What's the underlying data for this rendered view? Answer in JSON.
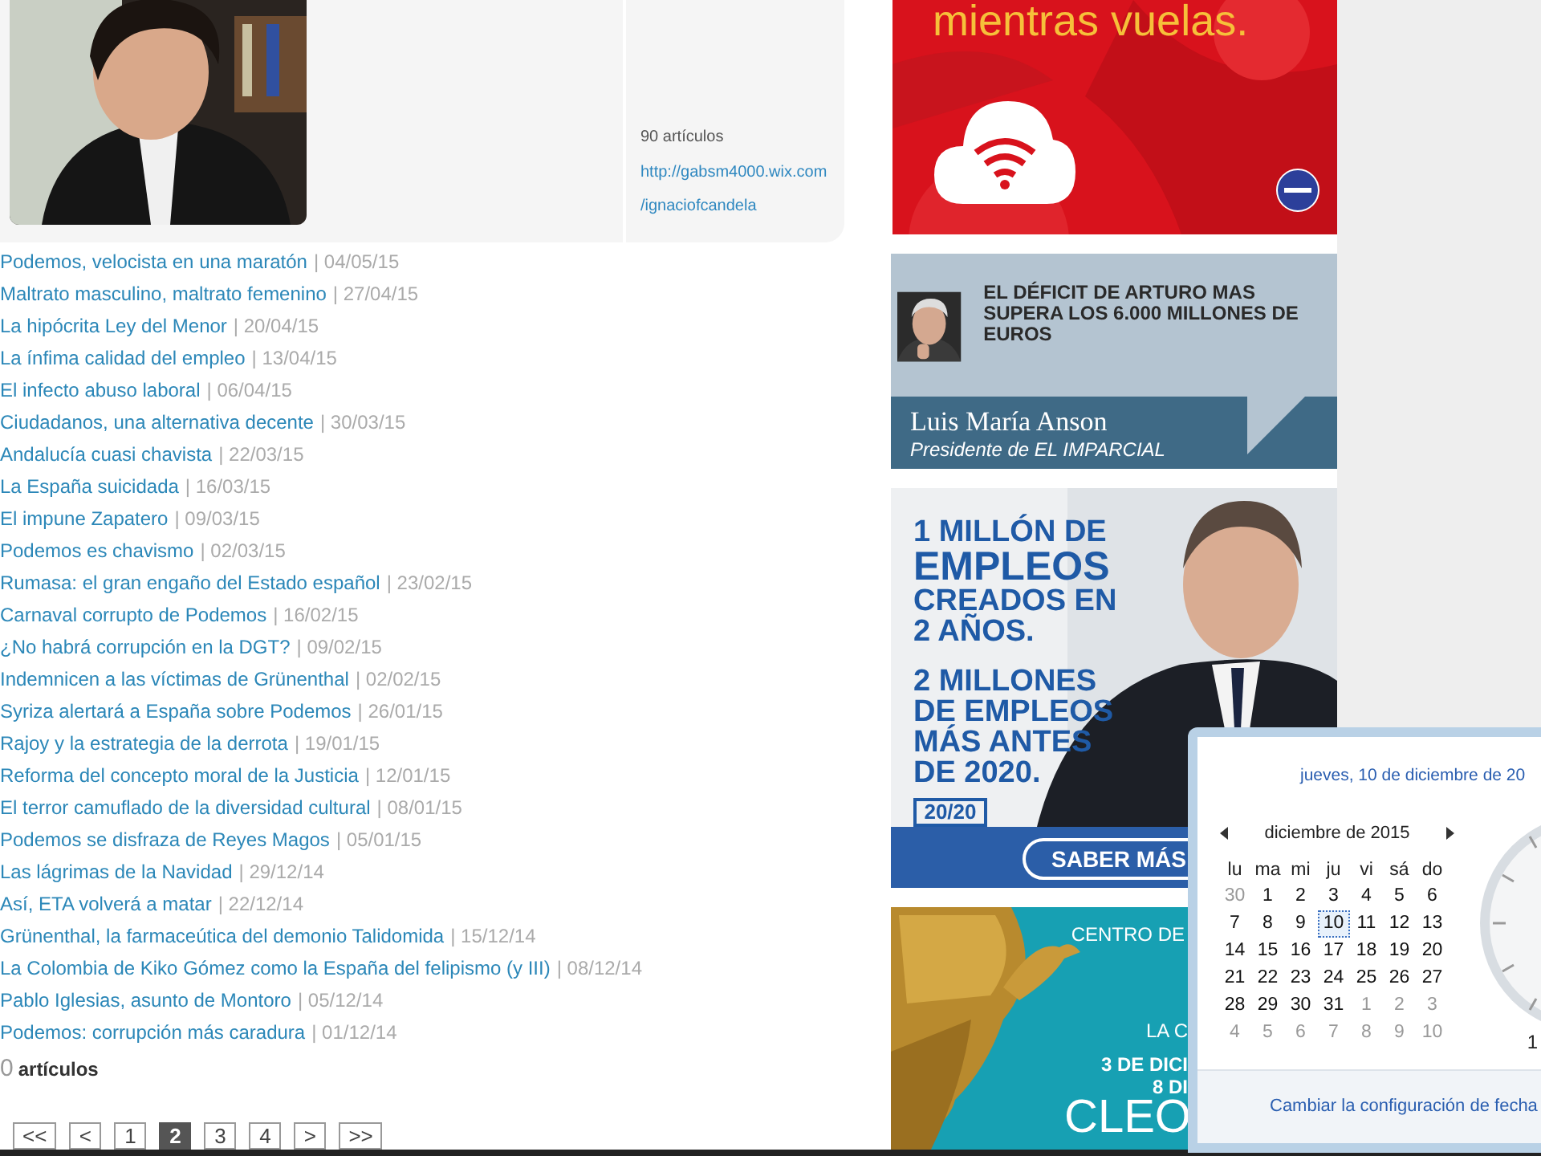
{
  "author_card": {
    "stats": "90 artículos",
    "link_lines": [
      "http://gabsm4000.wix.com",
      "/ignaciofcandela"
    ]
  },
  "articles": [
    {
      "title": "Podemos, velocista en una maratón",
      "date": "| 04/05/15"
    },
    {
      "title": "Maltrato masculino, maltrato femenino",
      "date": "| 27/04/15"
    },
    {
      "title": "La hipócrita Ley del Menor",
      "date": "| 20/04/15"
    },
    {
      "title": "La ínfima calidad del empleo",
      "date": "| 13/04/15"
    },
    {
      "title": "El infecto abuso laboral",
      "date": "| 06/04/15"
    },
    {
      "title": "Ciudadanos, una alternativa decente",
      "date": "| 30/03/15"
    },
    {
      "title": "Andalucía cuasi chavista",
      "date": "| 22/03/15"
    },
    {
      "title": "La España suicidada",
      "date": "| 16/03/15"
    },
    {
      "title": "El impune Zapatero",
      "date": "| 09/03/15"
    },
    {
      "title": "Podemos es chavismo",
      "date": "| 02/03/15"
    },
    {
      "title": "Rumasa: el gran engaño del Estado español",
      "date": "| 23/02/15"
    },
    {
      "title": "Carnaval corrupto de Podemos",
      "date": "| 16/02/15"
    },
    {
      "title": "¿No habrá corrupción en la DGT?",
      "date": "| 09/02/15"
    },
    {
      "title": "Indemnicen a las víctimas de Grünenthal",
      "date": "| 02/02/15"
    },
    {
      "title": "Syriza alertará a España sobre Podemos",
      "date": "| 26/01/15"
    },
    {
      "title": "Rajoy y la estrategia de la derrota",
      "date": "| 19/01/15"
    },
    {
      "title": "Reforma del concepto moral de la Justicia",
      "date": "| 12/01/15"
    },
    {
      "title": "El terror camuflado de la diversidad cultural",
      "date": "| 08/01/15"
    },
    {
      "title": "Podemos se disfraza de Reyes Magos",
      "date": "| 05/01/15"
    },
    {
      "title": "Las lágrimas de la Navidad",
      "date": "| 29/12/14"
    },
    {
      "title": "Así, ETA volverá a matar",
      "date": "| 22/12/14"
    },
    {
      "title": "Grünenthal, la farmaceútica del demonio Talidomida",
      "date": "| 15/12/14"
    },
    {
      "title": "La Colombia de Kiko Gómez como la España del felipismo (y III)",
      "date": "| 08/12/14"
    },
    {
      "title": "Pablo Iglesias, asunto de Montoro",
      "date": "| 05/12/14"
    },
    {
      "title": "Podemos: corrupción más caradura",
      "date": "| 01/12/14"
    }
  ],
  "article_count": {
    "number": "0",
    "label": "artículos"
  },
  "pagination": [
    {
      "label": "<<",
      "selected": false
    },
    {
      "label": "<",
      "selected": false
    },
    {
      "label": "1",
      "selected": false
    },
    {
      "label": "2",
      "selected": true
    },
    {
      "label": "3",
      "selected": false
    },
    {
      "label": "4",
      "selected": false
    },
    {
      "label": ">",
      "selected": false
    },
    {
      "label": ">>",
      "selected": false
    }
  ],
  "ads": [
    {
      "kind": "wifi",
      "headline": "mientras vuelas."
    },
    {
      "kind": "opinion",
      "headline": "EL DÉFICIT DE ARTURO MAS SUPERA LOS 6.000 MILLONES DE EUROS",
      "name": "Luis María Anson",
      "role": "Presidente de EL IMPARCIAL"
    },
    {
      "kind": "jobs",
      "lines": [
        {
          "text": "1 MILLÓN DE",
          "emphasis": false
        },
        {
          "text": "EMPLEOS",
          "emphasis": true
        },
        {
          "text": "CREADOS EN",
          "emphasis": false
        },
        {
          "text": "2 AÑOS.",
          "emphasis": false
        },
        {
          "text": "2 MILLONES",
          "emphasis": false
        },
        {
          "text": "DE EMPLEOS",
          "emphasis": false
        },
        {
          "text": "MÁS ANTES",
          "emphasis": false
        },
        {
          "text": "DE 2020.",
          "emphasis": false
        }
      ],
      "tag": "20/20",
      "button": "SABER MÁS"
    },
    {
      "kind": "exhibition",
      "lines": [
        "CENTRO DE",
        "LA C",
        "3 DE DICI",
        "8 DI"
      ],
      "logo": "CLEO"
    }
  ],
  "calendar": {
    "date_title": "jueves, 10 de diciembre de 20",
    "month": "diciembre de 2015",
    "weekdays": [
      "lu",
      "ma",
      "mi",
      "ju",
      "vi",
      "sá",
      "do"
    ],
    "days": [
      {
        "label": "30",
        "current_month": false,
        "selected": false
      },
      {
        "label": "1",
        "current_month": true,
        "selected": false
      },
      {
        "label": "2",
        "current_month": true,
        "selected": false
      },
      {
        "label": "3",
        "current_month": true,
        "selected": false
      },
      {
        "label": "4",
        "current_month": true,
        "selected": false
      },
      {
        "label": "5",
        "current_month": true,
        "selected": false
      },
      {
        "label": "6",
        "current_month": true,
        "selected": false
      },
      {
        "label": "7",
        "current_month": true,
        "selected": false
      },
      {
        "label": "8",
        "current_month": true,
        "selected": false
      },
      {
        "label": "9",
        "current_month": true,
        "selected": false
      },
      {
        "label": "10",
        "current_month": true,
        "selected": true
      },
      {
        "label": "11",
        "current_month": true,
        "selected": false
      },
      {
        "label": "12",
        "current_month": true,
        "selected": false
      },
      {
        "label": "13",
        "current_month": true,
        "selected": false
      },
      {
        "label": "14",
        "current_month": true,
        "selected": false
      },
      {
        "label": "15",
        "current_month": true,
        "selected": false
      },
      {
        "label": "16",
        "current_month": true,
        "selected": false
      },
      {
        "label": "17",
        "current_month": true,
        "selected": false
      },
      {
        "label": "18",
        "current_month": true,
        "selected": false
      },
      {
        "label": "19",
        "current_month": true,
        "selected": false
      },
      {
        "label": "20",
        "current_month": true,
        "selected": false
      },
      {
        "label": "21",
        "current_month": true,
        "selected": false
      },
      {
        "label": "22",
        "current_month": true,
        "selected": false
      },
      {
        "label": "23",
        "current_month": true,
        "selected": false
      },
      {
        "label": "24",
        "current_month": true,
        "selected": false
      },
      {
        "label": "25",
        "current_month": true,
        "selected": false
      },
      {
        "label": "26",
        "current_month": true,
        "selected": false
      },
      {
        "label": "27",
        "current_month": true,
        "selected": false
      },
      {
        "label": "28",
        "current_month": true,
        "selected": false
      },
      {
        "label": "29",
        "current_month": true,
        "selected": false
      },
      {
        "label": "30",
        "current_month": true,
        "selected": false
      },
      {
        "label": "31",
        "current_month": true,
        "selected": false
      },
      {
        "label": "1",
        "current_month": false,
        "selected": false
      },
      {
        "label": "2",
        "current_month": false,
        "selected": false
      },
      {
        "label": "3",
        "current_month": false,
        "selected": false
      },
      {
        "label": "4",
        "current_month": false,
        "selected": false
      },
      {
        "label": "5",
        "current_month": false,
        "selected": false
      },
      {
        "label": "6",
        "current_month": false,
        "selected": false
      },
      {
        "label": "7",
        "current_month": false,
        "selected": false
      },
      {
        "label": "8",
        "current_month": false,
        "selected": false
      },
      {
        "label": "9",
        "current_month": false,
        "selected": false
      },
      {
        "label": "10",
        "current_month": false,
        "selected": false
      }
    ],
    "clock_label": "1",
    "settings_link": "Cambiar la configuración de fecha"
  }
}
